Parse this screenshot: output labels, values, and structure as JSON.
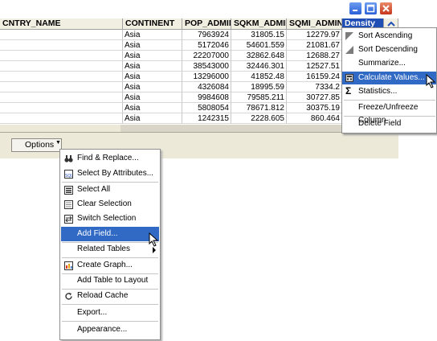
{
  "window": {
    "buttons": [
      "minimize",
      "maximize",
      "close"
    ]
  },
  "table": {
    "columns": [
      "CNTRY_NAME",
      "CONTINENT",
      "POP_ADMIN",
      "SQKM_ADMIN",
      "SQMI_ADMIN",
      "Density"
    ],
    "rows": [
      [
        "",
        "Asia",
        "7963924",
        "31805.15",
        "12279.97"
      ],
      [
        "",
        "Asia",
        "5172046",
        "54601.559",
        "21081.67"
      ],
      [
        "",
        "Asia",
        "22207000",
        "32862.648",
        "12688.27"
      ],
      [
        "",
        "Asia",
        "38543000",
        "32446.301",
        "12527.51"
      ],
      [
        "",
        "Asia",
        "13296000",
        "41852.48",
        "16159.24"
      ],
      [
        "",
        "Asia",
        "4326084",
        "18995.59",
        "7334.2"
      ],
      [
        "",
        "Asia",
        "9984608",
        "79585.211",
        "30727.85"
      ],
      [
        "",
        "Asia",
        "5808054",
        "78671.812",
        "30375.19"
      ],
      [
        "",
        "Asia",
        "1242315",
        "2228.605",
        "860.464"
      ]
    ]
  },
  "toolbar": {
    "options_label": "Options"
  },
  "column_menu": {
    "items": [
      "Sort Ascending",
      "Sort Descending",
      "Summarize...",
      "Calculate Values...",
      "Statistics...",
      "Freeze/Unfreeze Column",
      "Delete Field"
    ],
    "highlighted": "Calculate Values..."
  },
  "options_menu": {
    "items": [
      "Find & Replace...",
      "Select By Attributes...",
      "Select All",
      "Clear Selection",
      "Switch Selection",
      "Add Field...",
      "Related Tables",
      "Create Graph...",
      "Add Table to Layout",
      "Reload Cache",
      "Export...",
      "Appearance..."
    ],
    "highlighted": "Add Field..."
  },
  "colors": {
    "highlight": "#316ac5",
    "selected_header": "#1f4fb4",
    "toolbar_bg": "#ece9d8"
  }
}
